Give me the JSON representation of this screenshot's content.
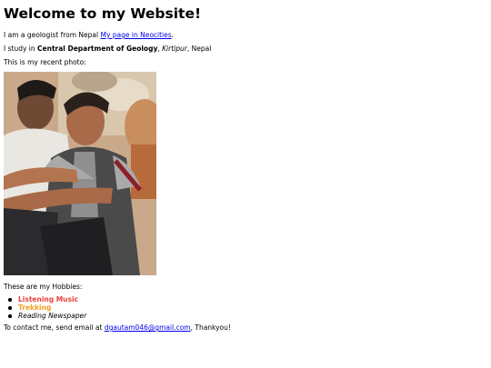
{
  "heading": "Welcome to my Website!",
  "intro": {
    "text": "I am a geologist from Nepal ",
    "link_label": "My page in Neocities",
    "after": "."
  },
  "study": {
    "prefix": "I study in ",
    "department": "Central Department of Geology",
    "comma1": ", ",
    "place": "Kirtipur",
    "suffix": ", Nepal"
  },
  "photo_caption": "This is my recent photo:",
  "hobbies_intro": "These are my Hobbies:",
  "hobbies": [
    {
      "label": "Listening Music",
      "color": "#e8413c",
      "style": "bold"
    },
    {
      "label": "Trekking",
      "color": "#f0a020",
      "style": "bold"
    },
    {
      "label": "Reading Newspaper",
      "color": "#000000",
      "style": "italic"
    }
  ],
  "contact": {
    "prefix": "To contact me, send email at ",
    "email": "dgautam046@gmail.com",
    "suffix": ", Thankyou!"
  }
}
